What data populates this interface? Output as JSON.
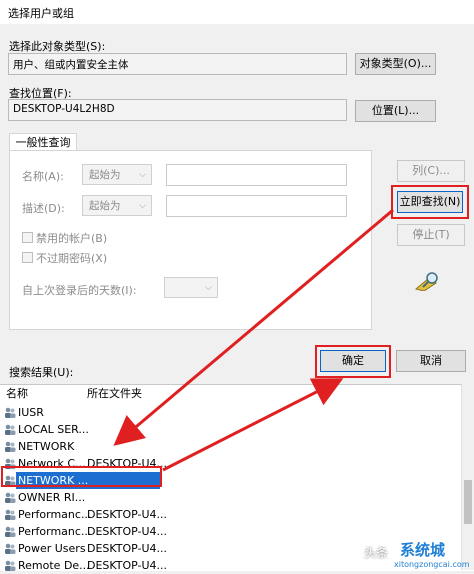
{
  "window": {
    "title": "选择用户或组"
  },
  "object_type": {
    "label": "选择此对象类型(S):",
    "value": "用户、组或内置安全主体",
    "button": "对象类型(O)..."
  },
  "location": {
    "label": "查找位置(F):",
    "value": "DESKTOP-U4L2H8D",
    "button": "位置(L)..."
  },
  "tabs": {
    "general": "一般性查询"
  },
  "query": {
    "name_label": "名称(A):",
    "name_mode": "起始为",
    "desc_label": "描述(D):",
    "desc_mode": "起始为",
    "disabled_accounts": "禁用的帐户(B)",
    "no_expire_pwd": "不过期密码(X)",
    "days_since_login": "自上次登录后的天数(I):"
  },
  "side_buttons": {
    "columns": "列(C)...",
    "find_now": "立即查找(N)",
    "stop": "停止(T)"
  },
  "dialog_buttons": {
    "ok": "确定",
    "cancel": "取消"
  },
  "results": {
    "label": "搜索结果(U):",
    "columns": [
      "名称",
      "所在文件夹"
    ],
    "rows": [
      {
        "name": "IUSR",
        "folder": ""
      },
      {
        "name": "LOCAL SER...",
        "folder": ""
      },
      {
        "name": "NETWORK",
        "folder": ""
      },
      {
        "name": "Network C...",
        "folder": "DESKTOP-U4..."
      },
      {
        "name": "NETWORK ...",
        "folder": "",
        "selected": true
      },
      {
        "name": "OWNER RI...",
        "folder": ""
      },
      {
        "name": "Performanc...",
        "folder": "DESKTOP-U4..."
      },
      {
        "name": "Performanc...",
        "folder": "DESKTOP-U4..."
      },
      {
        "name": "Power Users",
        "folder": "DESKTOP-U4..."
      },
      {
        "name": "Remote De...",
        "folder": "DESKTOP-U4..."
      }
    ]
  },
  "watermark": {
    "text": "系统城",
    "sub": "xitongzongcai.com",
    "prefix": "头条"
  },
  "colors": {
    "highlight": "#e02020",
    "selection": "#1c6fd0",
    "arrow": "#e02020"
  }
}
